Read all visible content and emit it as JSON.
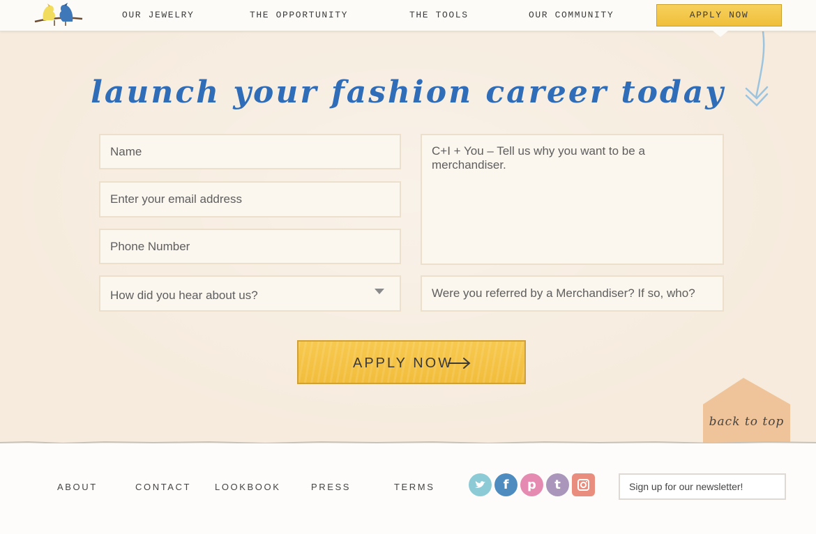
{
  "nav": {
    "items": [
      {
        "label": "OUR JEWELRY"
      },
      {
        "label": "THE OPPORTUNITY"
      },
      {
        "label": "THE TOOLS"
      },
      {
        "label": "OUR COMMUNITY"
      }
    ],
    "apply_label": "APPLY NOW"
  },
  "logo": {
    "icon": "two-birds-on-branch",
    "bird_colors": [
      "#f2dc5e",
      "#3e78b8"
    ]
  },
  "hero": {
    "headline": "launch your fashion career today"
  },
  "form": {
    "name_placeholder": "Name",
    "email_placeholder": "Enter your email address",
    "phone_placeholder": "Phone Number",
    "source_select": {
      "selected": "How did you hear about us?"
    },
    "message_placeholder": "C+I + You – Tell us why you want to be a merchandiser.",
    "referral_placeholder": "Were you referred by a Merchandiser? If so, who?",
    "submit_label": "APPLY NOW",
    "submit_icon": "long-right-arrow"
  },
  "back_to_top": {
    "label": "back to top"
  },
  "footer": {
    "links": [
      {
        "label": "ABOUT"
      },
      {
        "label": "CONTACT"
      },
      {
        "label": "LOOKBOOK"
      },
      {
        "label": "PRESS"
      },
      {
        "label": "TERMS"
      }
    ],
    "social": [
      {
        "name": "twitter-icon",
        "glyph": "t",
        "color": "#8ccbd6"
      },
      {
        "name": "facebook-icon",
        "glyph": "f",
        "color": "#4e8cbf"
      },
      {
        "name": "pinterest-icon",
        "glyph": "p",
        "color": "#e58bb1"
      },
      {
        "name": "tumblr-icon",
        "glyph": "t",
        "color": "#a996ba"
      },
      {
        "name": "instagram-icon",
        "glyph": "◎",
        "color": "#e98e7f"
      }
    ],
    "newsletter_placeholder": "Sign up for our newsletter!"
  },
  "colors": {
    "accent_yellow": "#f2bd3c",
    "headline_blue": "#2f6db8",
    "paper": "#f6ebdd",
    "back_to_top_tab": "#efc49a"
  }
}
